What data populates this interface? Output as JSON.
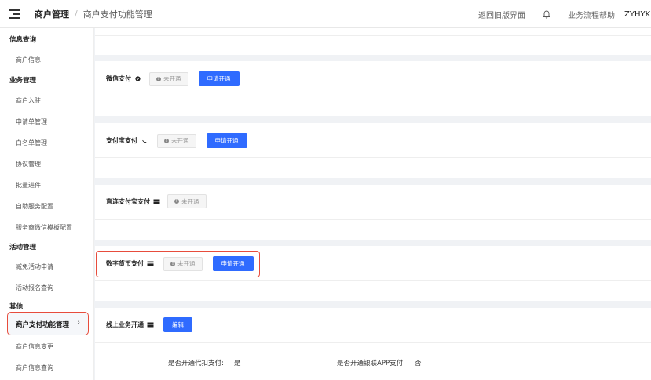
{
  "header": {
    "breadcrumb_1": "商户管理",
    "breadcrumb_sep": "/",
    "breadcrumb_2": "商户支付功能管理",
    "legacy_link": "返回旧版界面",
    "help_link": "业务流程帮助",
    "user_name": "ZYHYK"
  },
  "sidebar": {
    "groups": [
      "信息查询",
      "业务管理",
      "活动管理",
      "其他"
    ],
    "items": [
      "商户信息",
      "商户入驻",
      "申请单管理",
      "白名单管理",
      "协议管理",
      "批量进件",
      "自助服务配置",
      "服务商微信模板配置",
      "减免活动申请",
      "活动报名查询",
      "商户支付功能管理",
      "商户信息变更",
      "商户信息查询"
    ],
    "active_arrow": "›"
  },
  "payments": [
    {
      "label": "微信支付",
      "status": "未开通",
      "action": "申请开通"
    },
    {
      "label": "支付宝支付",
      "status": "未开通",
      "action": "申请开通"
    },
    {
      "label": "直连支付宝支付",
      "status": "未开通"
    },
    {
      "label": "数字货币支付",
      "status": "未开通",
      "action": "申请开通"
    }
  ],
  "online": {
    "label": "线上业务开通",
    "action": "编辑",
    "field_1_label": "是否开通代扣支付:",
    "field_1_value": "是",
    "field_2_label": "是否开通银联APP支付:",
    "field_2_value": "否"
  },
  "colors": {
    "primary": "#2f6bff",
    "highlight": "#e74c3c"
  }
}
